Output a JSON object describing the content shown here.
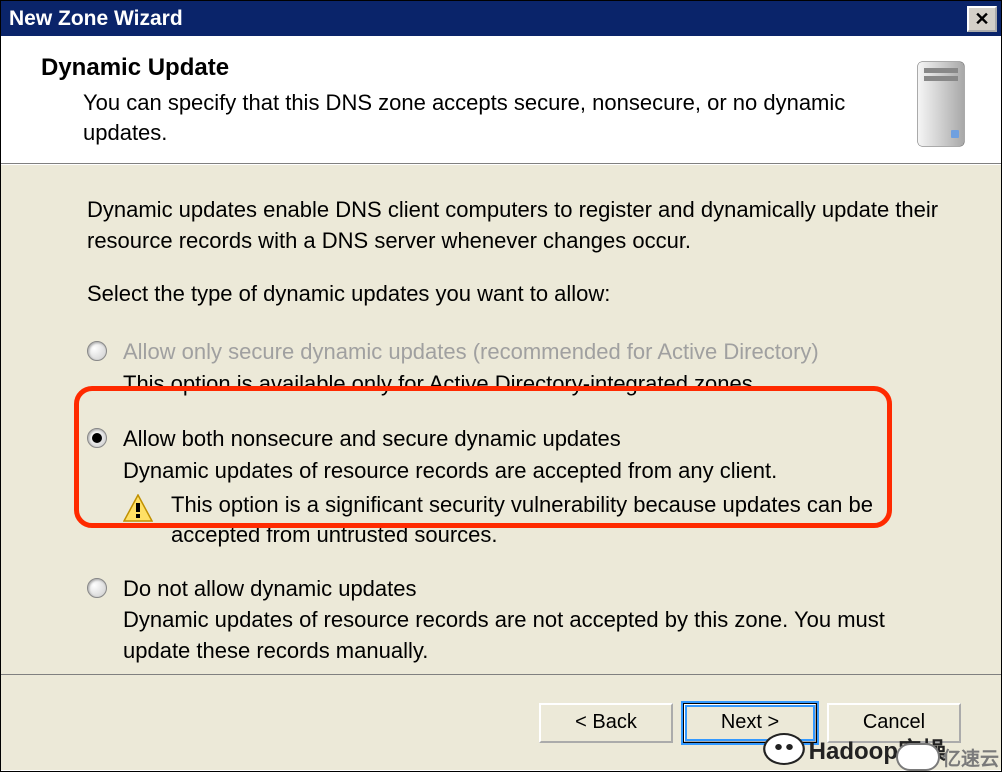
{
  "window": {
    "title": "New Zone Wizard",
    "close_tooltip": "Close"
  },
  "header": {
    "title": "Dynamic Update",
    "subtitle": "You can specify that this DNS zone accepts secure, nonsecure, or no dynamic updates."
  },
  "body": {
    "intro": "Dynamic updates enable DNS client computers to register and dynamically update their resource records with a DNS server whenever changes occur.",
    "select_prompt": "Select the type of dynamic updates you want to allow:",
    "options": {
      "secure_only": {
        "label": "Allow only secure dynamic updates (recommended for Active Directory)",
        "desc": "This option is available only for Active Directory-integrated zones.",
        "enabled": false,
        "selected": false
      },
      "both": {
        "label": "Allow both nonsecure and secure dynamic updates",
        "desc": "Dynamic updates of resource records are accepted from any client.",
        "warning": "This option is a significant security vulnerability because updates can be accepted from untrusted sources.",
        "enabled": true,
        "selected": true
      },
      "none": {
        "label": "Do not allow dynamic updates",
        "desc": "Dynamic updates of resource records are not accepted by this zone. You must update these records manually.",
        "enabled": true,
        "selected": false
      }
    }
  },
  "footer": {
    "back": "< Back",
    "next": "Next >",
    "cancel": "Cancel"
  },
  "watermarks": {
    "wm1": "Hadoop实操",
    "wm2": "亿速云"
  }
}
